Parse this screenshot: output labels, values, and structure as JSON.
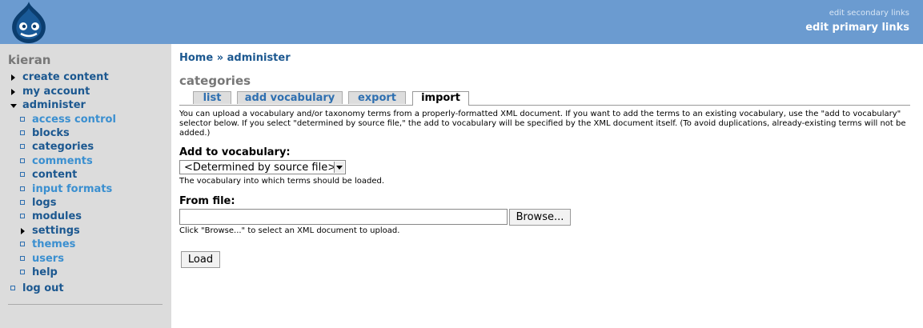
{
  "header": {
    "logo_icon": "drupal-drop-icon",
    "secondary_links": "edit secondary links",
    "primary_links": "edit primary links",
    "background": "#6b9bd0"
  },
  "sidebar": {
    "username": "kieran",
    "items": [
      {
        "label": "create content",
        "state": "collapsed"
      },
      {
        "label": "my account",
        "state": "collapsed"
      },
      {
        "label": "administer",
        "state": "expanded"
      },
      {
        "label": "access control",
        "state": "leaf"
      },
      {
        "label": "blocks",
        "state": "leaf"
      },
      {
        "label": "categories",
        "state": "leaf"
      },
      {
        "label": "comments",
        "state": "leaf"
      },
      {
        "label": "content",
        "state": "leaf"
      },
      {
        "label": "input formats",
        "state": "leaf"
      },
      {
        "label": "logs",
        "state": "leaf"
      },
      {
        "label": "modules",
        "state": "leaf"
      },
      {
        "label": "settings",
        "state": "collapsed"
      },
      {
        "label": "themes",
        "state": "leaf"
      },
      {
        "label": "users",
        "state": "leaf"
      },
      {
        "label": "help",
        "state": "leaf"
      },
      {
        "label": "log out",
        "state": "leaf"
      }
    ]
  },
  "breadcrumb": {
    "home": "Home",
    "separator": "»",
    "current": "administer"
  },
  "page_title": "categories",
  "tabs": [
    {
      "label": "list",
      "active": false
    },
    {
      "label": "add vocabulary",
      "active": false
    },
    {
      "label": "export",
      "active": false
    },
    {
      "label": "import",
      "active": true
    }
  ],
  "description": "You can upload a vocabulary and/or taxonomy terms from a properly-formatted XML document. If you want to add the terms to an existing vocabulary, use the \"add to vocabulary\" selector below. If you select \"determined by source file,\" the add to vocabulary will be specified by the XML document itself. (To avoid duplications, already-existing terms will not be added.)",
  "form": {
    "vocab_label": "Add to vocabulary:",
    "vocab_value": "<Determined by source file>",
    "vocab_hint": "The vocabulary into which terms should be loaded.",
    "file_label": "From file:",
    "file_value": "",
    "browse_label": "Browse...",
    "file_hint": "Click \"Browse...\" to select an XML document to upload.",
    "load_label": "Load"
  }
}
